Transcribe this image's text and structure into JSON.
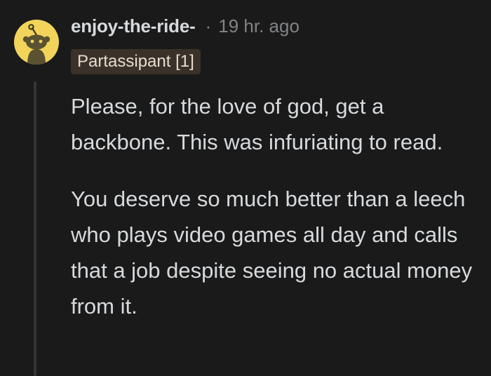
{
  "comment": {
    "username": "enjoy-the-ride-",
    "separator": "·",
    "timestamp": "19 hr. ago",
    "flair": "Partassipant [1]",
    "paragraphs": [
      "Please, for the love of god, get a backbone. This was infuriating to read.",
      "You deserve so much better than a leech who plays video games all day and calls that a job despite seeing no actual money from it."
    ]
  },
  "colors": {
    "background": "#1a1a1b",
    "avatar_bg": "#f2d45b",
    "flair_bg": "#3a322a",
    "meta_text": "#818384",
    "body_text": "#d7dadc"
  },
  "icons": {
    "avatar": "snoo-avatar-icon"
  }
}
